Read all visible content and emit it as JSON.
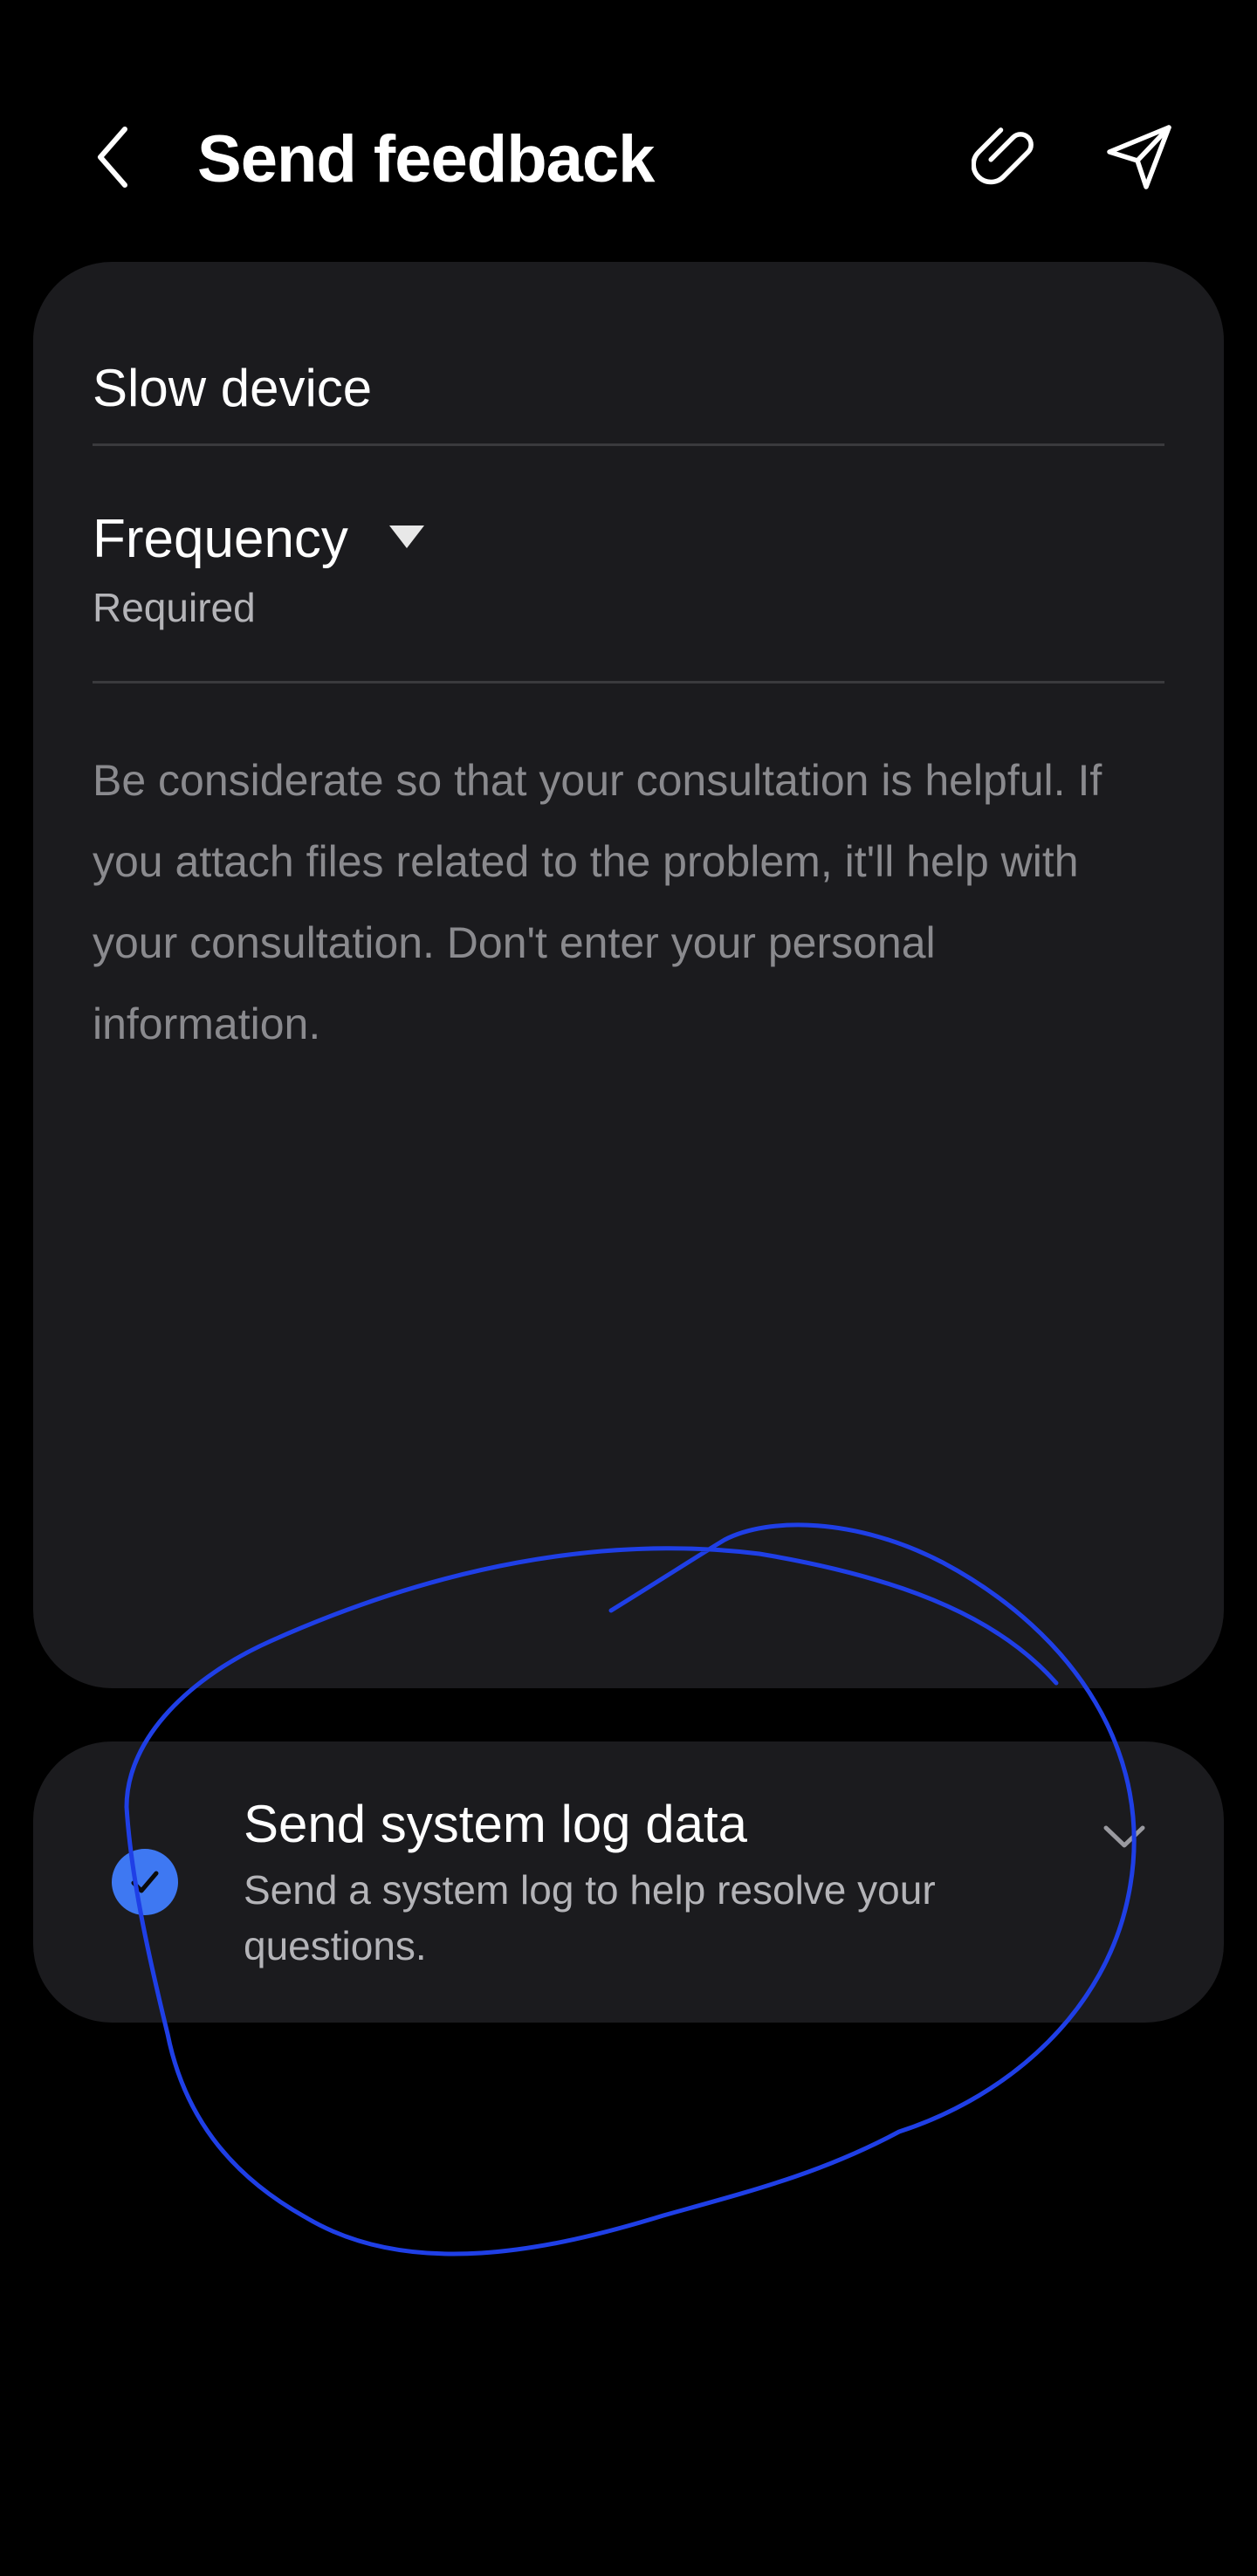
{
  "header": {
    "title": "Send feedback",
    "back_icon": "chevron-left-icon",
    "attach_icon": "paperclip-icon",
    "send_icon": "send-icon"
  },
  "feedback": {
    "category": "Slow device",
    "frequency": {
      "label": "Frequency",
      "sub": "Required"
    },
    "details_placeholder": "Be considerate so that your consultation is helpful. If you attach files related to the problem, it'll help with your consultation. Don't enter your personal information."
  },
  "system_log": {
    "title": "Send system log data",
    "description": "Send a system log to help resolve your questions.",
    "checked": true,
    "check_color": "#3e78f2"
  },
  "colors": {
    "background": "#000000",
    "card": "#1b1b1e",
    "annotation": "#1f3fe6"
  }
}
